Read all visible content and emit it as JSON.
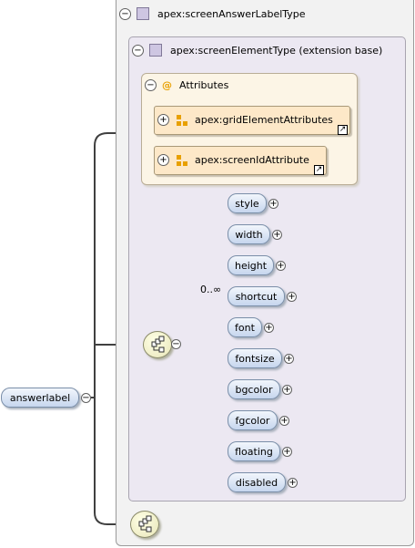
{
  "outer_type": {
    "label": "apex:screenAnswerLabelType"
  },
  "inner_type": {
    "label": "apex:screenElementType (extension base)"
  },
  "attributes": {
    "label": "Attributes",
    "items": [
      {
        "label": "apex:gridElementAttributes"
      },
      {
        "label": "apex:screenIdAttribute"
      }
    ]
  },
  "root_element": {
    "label": "answerlabel"
  },
  "sequence": {
    "children": [
      {
        "label": "style"
      },
      {
        "label": "width"
      },
      {
        "label": "height"
      },
      {
        "label": "shortcut",
        "cardinality": "0..∞"
      },
      {
        "label": "font"
      },
      {
        "label": "fontsize"
      },
      {
        "label": "bgcolor"
      },
      {
        "label": "fgcolor"
      },
      {
        "label": "floating"
      },
      {
        "label": "disabled"
      }
    ]
  },
  "symbols": {
    "collapse": "−",
    "expand": "+",
    "at": "@",
    "link": "↗"
  },
  "icons": [
    "type-icon",
    "attribute-group-icon",
    "sequence-icon",
    "expand-icon",
    "collapse-icon",
    "link-arrow-icon"
  ]
}
